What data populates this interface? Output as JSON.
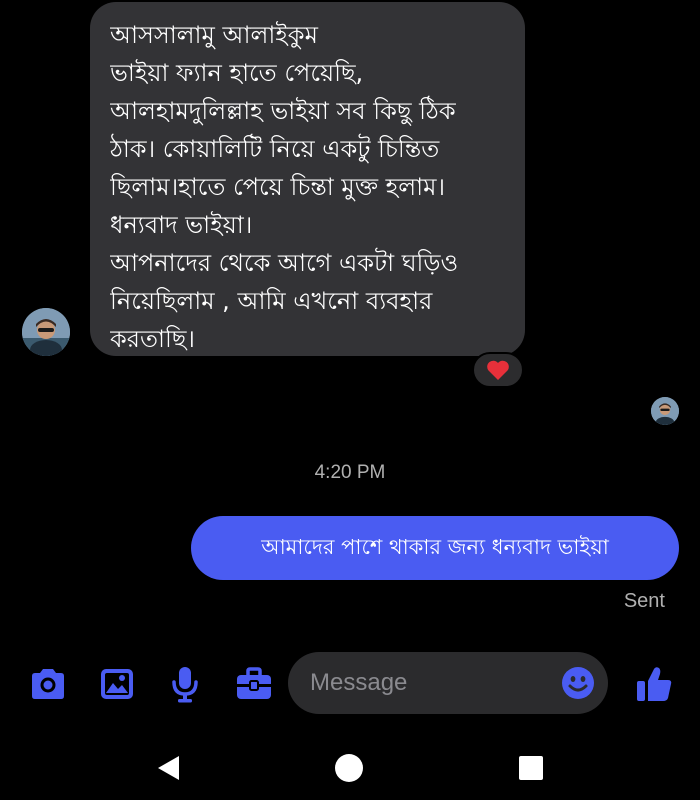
{
  "conversation": {
    "received_message": {
      "lines": [
        "আসসালামু আলাইকুম",
        "ভাইয়া ফ্যান হাতে পেয়েছি,",
        "আলহামদুলিল্লাহ ভাইয়া সব কিছু ঠিক",
        "ঠাক। কোয়ালিটি নিয়ে একটু চিন্তিত",
        "ছিলাম।হাতে পেয়ে চিন্তা মুক্ত হলাম।",
        "ধন্যবাদ ভাইয়া।",
        "আপনাদের থেকে আগে একটা ঘড়িও",
        "নিয়েছিলাম , আমি এখনো ব্যবহার",
        "করতাছি।"
      ],
      "reaction": "heart"
    },
    "timestamp": "4:20 PM",
    "sent_message": {
      "text": "আমাদের পাশে থাকার জন্য ধন্যবাদ ভাইয়া",
      "status": "Sent"
    }
  },
  "composer": {
    "placeholder": "Message",
    "icons": [
      "camera-icon",
      "gallery-icon",
      "microphone-icon",
      "briefcase-icon",
      "emoji-icon",
      "thumbs-up-icon"
    ]
  },
  "navigation": {
    "buttons": [
      "back-icon",
      "home-icon",
      "recents-icon"
    ]
  },
  "colors": {
    "background": "#000000",
    "received_bubble": "#333336",
    "sent_bubble": "#4a5cf2",
    "accent_icon": "#4a5cf2",
    "reaction_heart": "#e8303a",
    "meta_text": "#b0b0b0"
  }
}
